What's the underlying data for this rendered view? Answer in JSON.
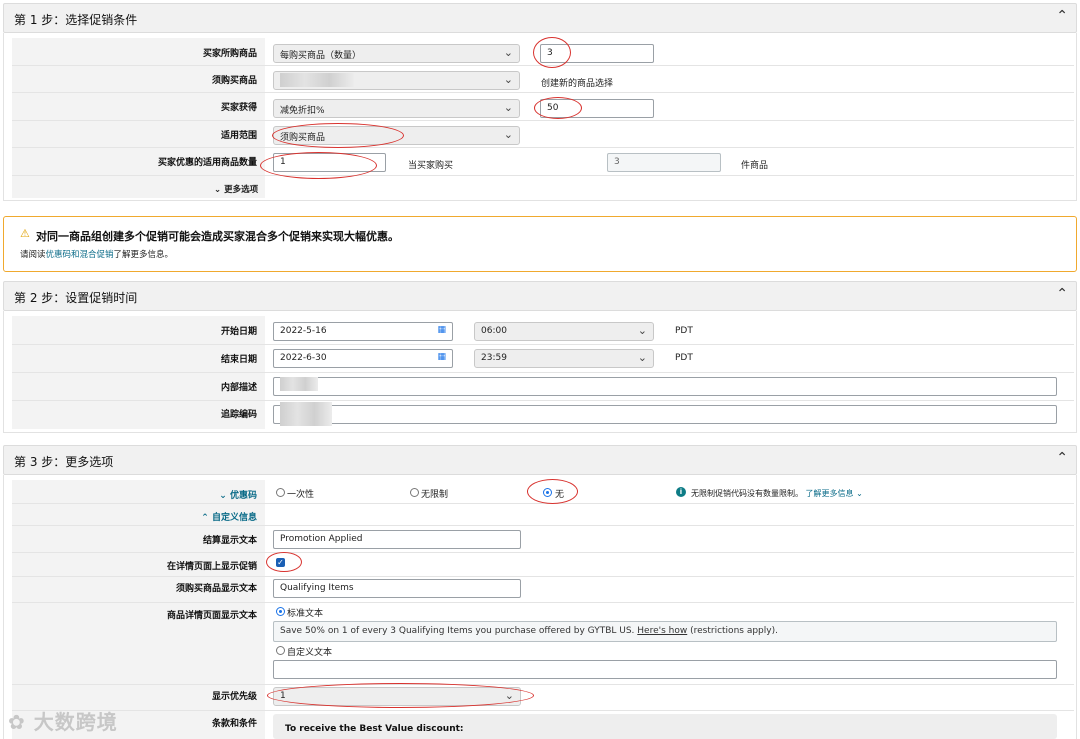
{
  "step1": {
    "title": "第 1 步：选择促销条件",
    "rows": {
      "buyer_purchase": {
        "label": "买家所购商品",
        "select": "每购买商品（数量）",
        "qty": "3"
      },
      "required_items": {
        "label": "须购买商品",
        "link": "创建新的商品选择"
      },
      "buyer_gets": {
        "label": "买家获得",
        "select": "减免折扣%",
        "value": "50"
      },
      "scope": {
        "label": "适用范围",
        "select": "须购买商品"
      },
      "qty_applied": {
        "label": "买家优惠的适用商品数量",
        "value": "1",
        "mid_text": "当买家购买",
        "buy_value": "3",
        "suffix": "件商品"
      }
    },
    "more_options": "更多选项"
  },
  "warning": {
    "title": "对同一商品组创建多个促销可能会造成买家混合多个促销来实现大幅优惠。",
    "body_prefix": "请阅读",
    "body_link": "优惠码和混合促销",
    "body_suffix": "了解更多信息。",
    "color": "#f0a92e"
  },
  "step2": {
    "title": "第 2 步：设置促销时间",
    "start": {
      "label": "开始日期",
      "date": "2022-5-16",
      "time": "06:00",
      "tz": "PDT"
    },
    "end": {
      "label": "结束日期",
      "date": "2022-6-30",
      "time": "23:59",
      "tz": "PDT"
    },
    "internal_desc": {
      "label": "内部描述"
    },
    "tracking_code": {
      "label": "追踪编码"
    }
  },
  "step3": {
    "title": "第 3 步：更多选项",
    "coupon": {
      "label": "优惠码",
      "opt1": "一次性",
      "opt2": "无限制",
      "opt3": "无",
      "info": "无限制促销代码没有数量限制。",
      "info_link": "了解更多信息"
    },
    "custom_info": "自定义信息",
    "checkout_text": {
      "label": "结算显示文本",
      "value": "Promotion Applied"
    },
    "show_on_detail": {
      "label": "在详情页面上显示促销"
    },
    "qualifying_text": {
      "label": "须购买商品显示文本",
      "value": "Qualifying Items"
    },
    "detail_text": {
      "label": "商品详情页面显示文本",
      "standard": "标准文本",
      "standard_prefix": "Save 50% on 1 of every 3 Qualifying Items you purchase offered by GYTBL US.",
      "standard_link": "Here's how",
      "standard_suffix": "(restrictions apply).",
      "custom": "自定义文本"
    },
    "priority": {
      "label": "显示优先级",
      "value": "1"
    },
    "terms": {
      "label": "条款和条件",
      "heading": "To receive the Best Value discount:"
    }
  },
  "watermark": "大数跨境"
}
